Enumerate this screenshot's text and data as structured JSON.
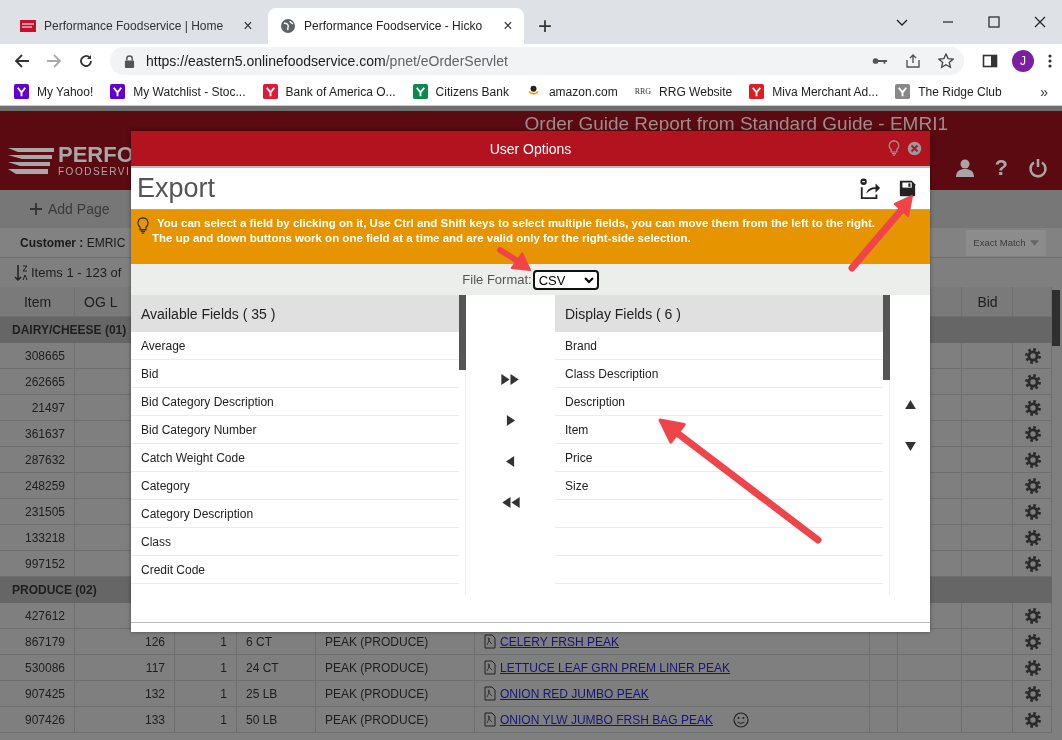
{
  "browser": {
    "tabs": [
      {
        "title": "Performance Foodservice | Home",
        "selected": false,
        "close": "×"
      },
      {
        "title": "Performance Foodservice - Hicko",
        "selected": true,
        "close": "×"
      }
    ],
    "new_tab": "+",
    "url_host": "https://eastern5.onlinefoodservice.com",
    "url_path": "/pnet/eOrderServlet",
    "avatar": "J",
    "bookmarks": [
      {
        "label": "My Yahoo!"
      },
      {
        "label": "My Watchlist - Stoc..."
      },
      {
        "label": "Bank of America  O..."
      },
      {
        "label": "Citizens Bank"
      },
      {
        "label": "amazon.com"
      },
      {
        "label": "RRG Website",
        "badge": "RRG"
      },
      {
        "label": "Miva Merchant Ad..."
      },
      {
        "label": "The Ridge Club"
      }
    ],
    "more_bookmarks": "»"
  },
  "app": {
    "logo_main": "PERFO",
    "logo_sub": "FOODSERVI",
    "title": "Order Guide Report from Standard Guide - EMRI1",
    "help": "?",
    "add_page": "Add Page",
    "customer": "**Customer :** EMRIC",
    "match_mode": "Exact Match",
    "items_range": "Items 1 - 123 of",
    "columns": {
      "item": "Item",
      "column_2": "OG L",
      "bid": "Bid"
    },
    "rows": [
      {
        "kind": "group",
        "label": "DAIRY/CHEESE (01)"
      },
      {
        "kind": "item",
        "item": "308665"
      },
      {
        "kind": "item",
        "item": "262665"
      },
      {
        "kind": "item",
        "item": "21497"
      },
      {
        "kind": "item",
        "item": "361637"
      },
      {
        "kind": "item",
        "item": "287632"
      },
      {
        "kind": "item",
        "item": "248259"
      },
      {
        "kind": "item",
        "item": "231505"
      },
      {
        "kind": "item",
        "item": "133218"
      },
      {
        "kind": "item",
        "item": "997152"
      },
      {
        "kind": "group",
        "label": "PRODUCE (02)"
      },
      {
        "kind": "item",
        "item": "427612"
      },
      {
        "kind": "item",
        "item": "867179",
        "column_2": "126",
        "column_3": "1",
        "size": "6 CT",
        "brand": "PEAK (PRODUCE)",
        "description": "CELERY FRSH PEAK",
        "feedback": false
      },
      {
        "kind": "item",
        "item": "530086",
        "column_2": "117",
        "column_3": "1",
        "size": "24 CT",
        "brand": "PEAK (PRODUCE)",
        "description": "LETTUCE LEAF GRN PREM LINER PEAK",
        "feedback": false
      },
      {
        "kind": "item",
        "item": "907425",
        "column_2": "132",
        "column_3": "1",
        "size": "25 LB",
        "brand": "PEAK (PRODUCE)",
        "description": "ONION RED JUMBO PEAK",
        "feedback": false
      },
      {
        "kind": "item",
        "item": "907426",
        "column_2": "133",
        "column_3": "1",
        "size": "50 LB",
        "brand": "PEAK (PRODUCE)",
        "description": "ONION YLW JUMBO FRSH BAG PEAK",
        "feedback": true
      }
    ]
  },
  "modal": {
    "title": "User Options",
    "heading": "Export",
    "hint_lines": [
      "You can select a field by clicking on it, Use Ctrl and Shift keys to select multiple fields, you can move them from the left to the right.",
      "The up and down buttons work on one field at a time and are valid only for the right-side selection."
    ],
    "file_format_label": "File Format:",
    "file_format": "CSV",
    "available": {
      "title": "Available Fields ( 35 )",
      "fields": [
        {
          "label": "Average",
          "selected": false
        },
        {
          "label": "Bid",
          "selected": false
        },
        {
          "label": "Bid Category Description",
          "selected": false
        },
        {
          "label": "Bid Category Number",
          "selected": false
        },
        {
          "label": "Catch Weight Code",
          "selected": false
        },
        {
          "label": "Category",
          "selected": false
        },
        {
          "label": "Category Description",
          "selected": false
        },
        {
          "label": "Class",
          "selected": false
        },
        {
          "label": "Credit Code",
          "selected": false
        }
      ]
    },
    "display": {
      "title": "Display Fields ( 6 )",
      "fields": [
        {
          "label": "Brand",
          "selected": false
        },
        {
          "label": "Class Description",
          "selected": false
        },
        {
          "label": "Description",
          "selected": false
        },
        {
          "label": "Item",
          "selected": false
        },
        {
          "label": "Price",
          "selected": false
        },
        {
          "label": "Size",
          "selected": false
        }
      ]
    }
  }
}
